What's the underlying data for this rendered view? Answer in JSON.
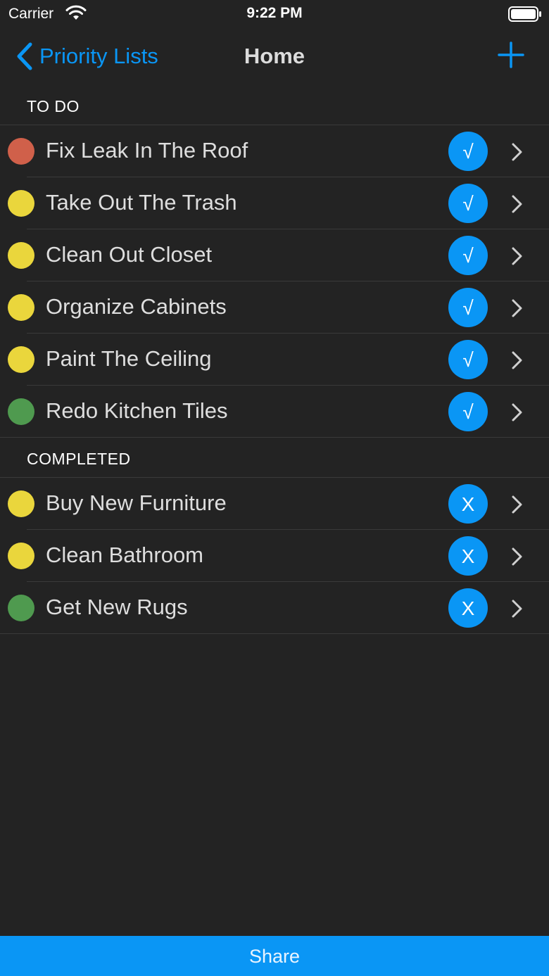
{
  "status_bar": {
    "carrier": "Carrier",
    "time": "9:22 PM",
    "icons": [
      "wifi-icon",
      "battery-icon"
    ]
  },
  "nav": {
    "back_label": "Priority Lists",
    "title": "Home",
    "back_icon": "chevron-left-icon",
    "add_icon": "plus-icon"
  },
  "colors": {
    "accent": "#0a96f5",
    "background": "#232323",
    "priority_high": "#d0604a",
    "priority_medium": "#ead63c",
    "priority_low": "#4f9a4f"
  },
  "sections": [
    {
      "title": "TO DO",
      "items": [
        {
          "label": "Fix Leak In The Roof",
          "priority": "high",
          "action": "√"
        },
        {
          "label": "Take Out The Trash",
          "priority": "medium",
          "action": "√"
        },
        {
          "label": "Clean Out Closet",
          "priority": "medium",
          "action": "√"
        },
        {
          "label": "Organize Cabinets",
          "priority": "medium",
          "action": "√"
        },
        {
          "label": "Paint The Ceiling",
          "priority": "medium",
          "action": "√"
        },
        {
          "label": "Redo Kitchen Tiles",
          "priority": "low",
          "action": "√"
        }
      ]
    },
    {
      "title": "COMPLETED",
      "items": [
        {
          "label": "Buy New Furniture",
          "priority": "medium",
          "action": "X"
        },
        {
          "label": "Clean Bathroom",
          "priority": "medium",
          "action": "X"
        },
        {
          "label": "Get New Rugs",
          "priority": "low",
          "action": "X"
        }
      ]
    }
  ],
  "footer": {
    "share_label": "Share"
  }
}
